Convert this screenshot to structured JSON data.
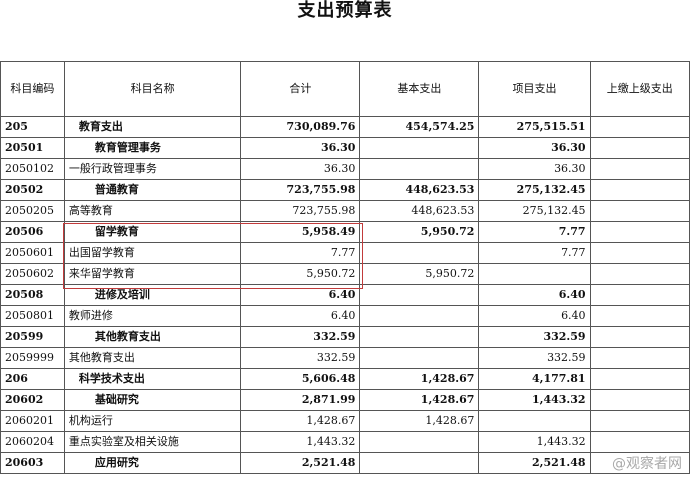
{
  "title": "支出预算表",
  "headers": [
    "科目编码",
    "科目名称",
    "合计",
    "基本支出",
    "项目支出",
    "上缴上级支出"
  ],
  "rows": [
    {
      "code": "205",
      "name": "教育支出",
      "total": "730,089.76",
      "basic": "454,574.25",
      "project": "275,515.51",
      "bold": true,
      "top": true
    },
    {
      "code": "20501",
      "name": "教育管理事务",
      "total": "36.30",
      "basic": "",
      "project": "36.30",
      "bold": true
    },
    {
      "code": "2050102",
      "name": "一般行政管理事务",
      "total": "36.30",
      "basic": "",
      "project": "36.30",
      "bold": false
    },
    {
      "code": "20502",
      "name": "普通教育",
      "total": "723,755.98",
      "basic": "448,623.53",
      "project": "275,132.45",
      "bold": true
    },
    {
      "code": "2050205",
      "name": "高等教育",
      "total": "723,755.98",
      "basic": "448,623.53",
      "project": "275,132.45",
      "bold": false
    },
    {
      "code": "20506",
      "name": "留学教育",
      "total": "5,958.49",
      "basic": "5,950.72",
      "project": "7.77",
      "bold": true
    },
    {
      "code": "2050601",
      "name": "出国留学教育",
      "total": "7.77",
      "basic": "",
      "project": "7.77",
      "bold": false
    },
    {
      "code": "2050602",
      "name": "来华留学教育",
      "total": "5,950.72",
      "basic": "5,950.72",
      "project": "",
      "bold": false
    },
    {
      "code": "20508",
      "name": "进修及培训",
      "total": "6.40",
      "basic": "",
      "project": "6.40",
      "bold": true
    },
    {
      "code": "2050801",
      "name": "教师进修",
      "total": "6.40",
      "basic": "",
      "project": "6.40",
      "bold": false
    },
    {
      "code": "20599",
      "name": "其他教育支出",
      "total": "332.59",
      "basic": "",
      "project": "332.59",
      "bold": true
    },
    {
      "code": "2059999",
      "name": "其他教育支出",
      "total": "332.59",
      "basic": "",
      "project": "332.59",
      "bold": false
    },
    {
      "code": "206",
      "name": "科学技术支出",
      "total": "5,606.48",
      "basic": "1,428.67",
      "project": "4,177.81",
      "bold": true,
      "top": true
    },
    {
      "code": "20602",
      "name": "基础研究",
      "total": "2,871.99",
      "basic": "1,428.67",
      "project": "1,443.32",
      "bold": true
    },
    {
      "code": "2060201",
      "name": "机构运行",
      "total": "1,428.67",
      "basic": "1,428.67",
      "project": "",
      "bold": false
    },
    {
      "code": "2060204",
      "name": "重点实验室及相关设施",
      "total": "1,443.32",
      "basic": "",
      "project": "1,443.32",
      "bold": false
    },
    {
      "code": "20603",
      "name": "应用研究",
      "total": "2,521.48",
      "basic": "",
      "project": "2,521.48",
      "bold": true
    }
  ],
  "watermark": "@观察者网",
  "highlight_color": "#c23b3b"
}
